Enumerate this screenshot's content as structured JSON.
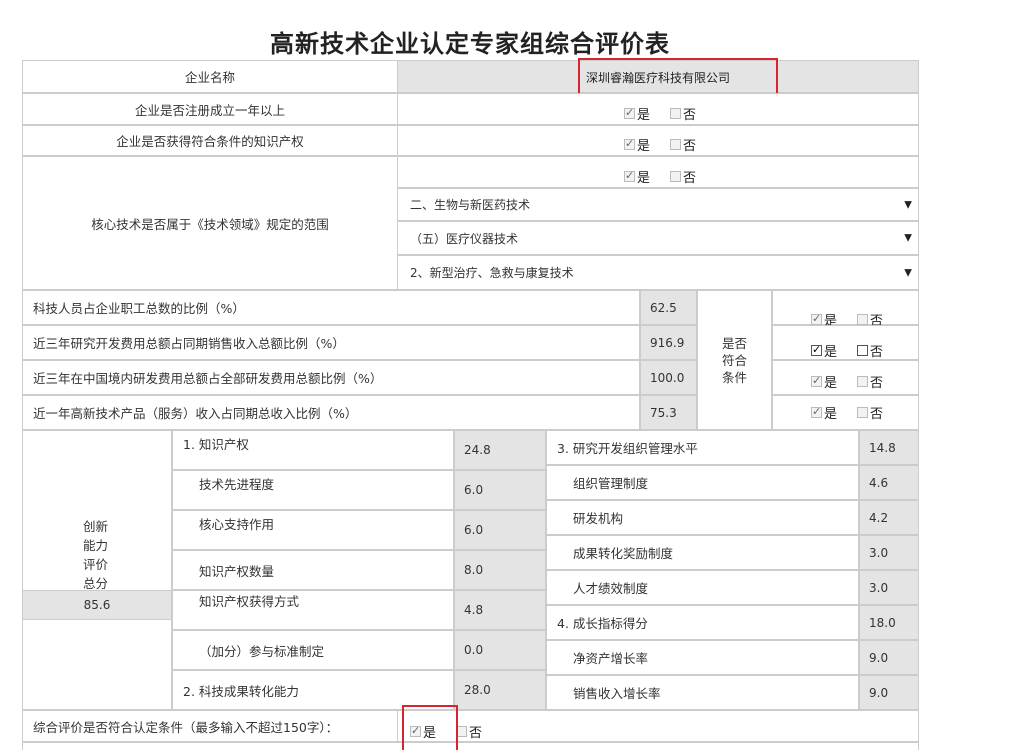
{
  "title": "高新技术企业认定专家组综合评价表",
  "company": {
    "label": "企业名称",
    "value": "深圳睿瀚医疗科技有限公司"
  },
  "rows": {
    "registered": "企业是否注册成立一年以上",
    "ip": "企业是否获得符合条件的知识产权",
    "core_tech": "核心技术是否属于《技术领域》规定的范围"
  },
  "yes": "是",
  "no": "否",
  "selects": [
    "二、生物与新医药技术",
    "（五）医疗仪器技术",
    "2、新型治疗、急救与康复技术"
  ],
  "select_arrow": "▼",
  "ratios": [
    {
      "label": "科技人员占企业职工总数的比例（%）",
      "value": "62.5"
    },
    {
      "label": "近三年研究开发费用总额占同期销售收入总额比例（%）",
      "value": "916.9"
    },
    {
      "label": "近三年在中国境内研发费用总额占全部研发费用总额比例（%）",
      "value": "100.0"
    },
    {
      "label": "近一年高新技术产品（服务）收入占同期总收入比例（%）",
      "value": "75.3"
    }
  ],
  "qualify_label": [
    "是否",
    "符合",
    "条件"
  ],
  "innovation": {
    "label": [
      "创新",
      "能力",
      "评价",
      "总分"
    ],
    "total": "85.6",
    "left": [
      {
        "label": "1. 知识产权",
        "value": "24.8"
      },
      {
        "label": "技术先进程度",
        "value": "6.0"
      },
      {
        "label": "核心支持作用",
        "value": "6.0"
      },
      {
        "label": "知识产权数量",
        "value": "8.0"
      },
      {
        "label": "知识产权获得方式",
        "value": "4.8"
      },
      {
        "label": "（加分）参与标准制定",
        "value": "0.0"
      },
      {
        "label": "2. 科技成果转化能力",
        "value": "28.0"
      }
    ],
    "right": [
      {
        "label": "3. 研究开发组织管理水平",
        "value": "14.8"
      },
      {
        "label": "组织管理制度",
        "value": "4.6"
      },
      {
        "label": "研发机构",
        "value": "4.2"
      },
      {
        "label": "成果转化奖励制度",
        "value": "3.0"
      },
      {
        "label": "人才绩效制度",
        "value": "3.0"
      },
      {
        "label": "4. 成长指标得分",
        "value": "18.0"
      },
      {
        "label": "净资产增长率",
        "value": "9.0"
      },
      {
        "label": "销售收入增长率",
        "value": "9.0"
      }
    ]
  },
  "final": {
    "label": "综合评价是否符合认定条件（最多输入不超过150字）："
  },
  "colors": {
    "highlight_red": "#d9232e",
    "gray_cell": "#e4e4e4",
    "border": "#cccccc"
  }
}
